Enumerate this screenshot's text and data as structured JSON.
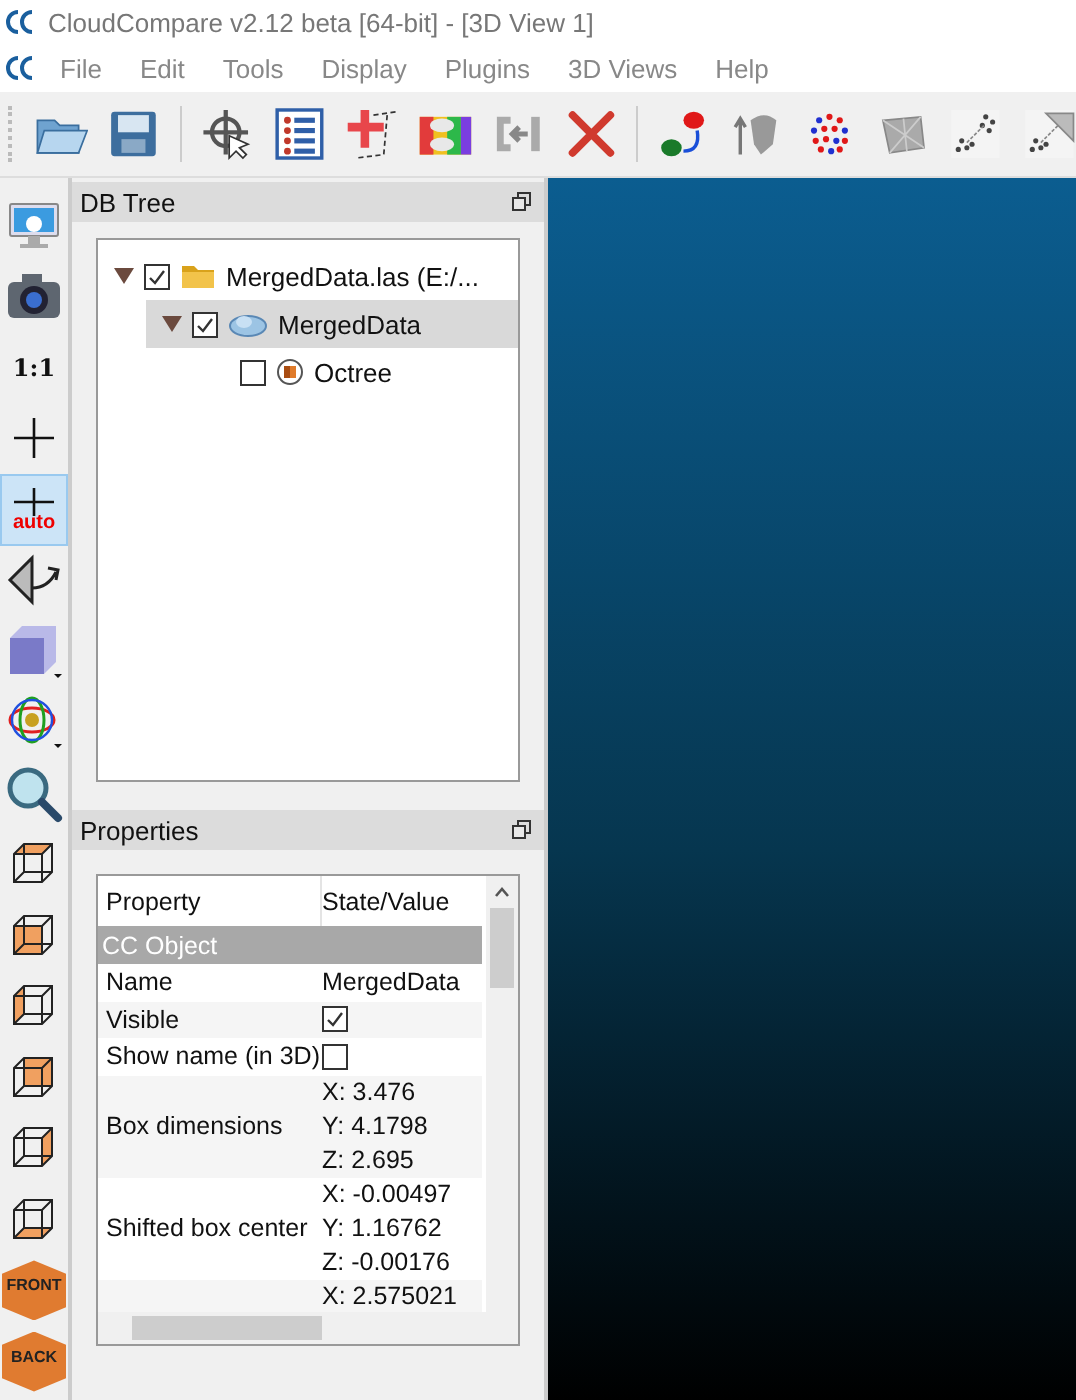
{
  "window": {
    "title": "CloudCompare v2.12 beta [64-bit] - [3D View 1]"
  },
  "menu": [
    "File",
    "Edit",
    "Tools",
    "Display",
    "Plugins",
    "3D Views",
    "Help"
  ],
  "left_toolbar": [
    {
      "kind": "display",
      "selected": false
    },
    {
      "kind": "camera",
      "selected": false
    },
    {
      "kind": "text",
      "label": "1:1",
      "selected": false
    },
    {
      "kind": "crosshair",
      "selected": false
    },
    {
      "kind": "auto",
      "label": "auto",
      "selected": true
    },
    {
      "kind": "rotate",
      "selected": false
    },
    {
      "kind": "cube",
      "selected": false
    },
    {
      "kind": "sphere",
      "selected": false
    },
    {
      "kind": "zoom",
      "selected": false
    },
    {
      "kind": "top",
      "selected": false
    },
    {
      "kind": "front",
      "selected": false
    },
    {
      "kind": "left",
      "selected": false
    },
    {
      "kind": "back",
      "selected": false
    },
    {
      "kind": "right",
      "selected": false
    },
    {
      "kind": "bottom",
      "selected": false
    },
    {
      "kind": "iso",
      "label": "FRONT",
      "selected": false
    },
    {
      "kind": "iso",
      "label": "BACK",
      "selected": false
    }
  ],
  "db_tree": {
    "title": "DB Tree",
    "items": [
      {
        "label": "MergedData.las (E:/...",
        "kind": "folder",
        "checked": true,
        "expanded": true,
        "selected": false,
        "children": [
          {
            "label": "MergedData",
            "kind": "cloud",
            "checked": true,
            "expanded": true,
            "selected": true,
            "children": [
              {
                "label": "Octree",
                "kind": "octree",
                "checked": false,
                "selected": false
              }
            ]
          }
        ]
      }
    ]
  },
  "properties": {
    "title": "Properties",
    "columns": [
      "Property",
      "State/Value"
    ],
    "section": "CC Object",
    "rows": [
      {
        "kind": "text",
        "label": "Name",
        "value": [
          "MergedData"
        ]
      },
      {
        "kind": "checkbox",
        "label": "Visible",
        "checked": true
      },
      {
        "kind": "checkbox",
        "label": "Show name (in 3D)",
        "checked": false
      },
      {
        "kind": "text",
        "label": "Box dimensions",
        "value": [
          "X: 3.476",
          "Y: 4.1798",
          "Z: 2.695"
        ]
      },
      {
        "kind": "text",
        "label": "Shifted box center",
        "value": [
          "X: -0.00497",
          "Y: 1.16762",
          "Z: -0.00176"
        ]
      },
      {
        "kind": "text",
        "value": [
          "X: 2.575021"
        ]
      }
    ]
  }
}
